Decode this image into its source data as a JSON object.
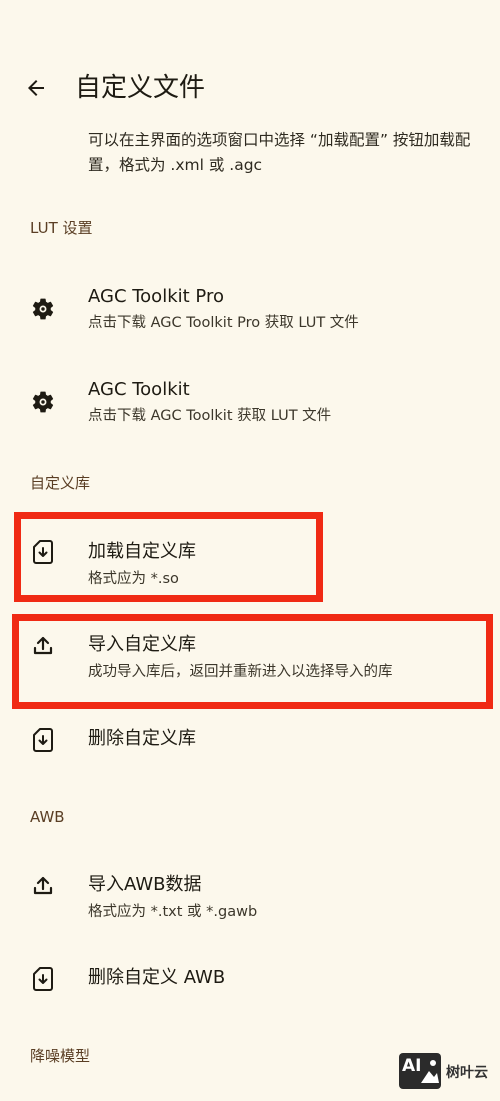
{
  "header": {
    "title": "自定义文件"
  },
  "description": "可以在主界面的选项窗口中选择 “加载配置” 按钮加载配置，格式为 .xml 或 .agc",
  "sections": {
    "lut": {
      "header": "LUT 设置",
      "items": [
        {
          "title": "AGC Toolkit Pro",
          "subtitle": "点击下载 AGC Toolkit Pro 获取 LUT 文件",
          "icon": "gear-icon"
        },
        {
          "title": "AGC Toolkit",
          "subtitle": "点击下载 AGC Toolkit 获取 LUT 文件",
          "icon": "gear-icon"
        }
      ]
    },
    "library": {
      "header": "自定义库",
      "items": [
        {
          "title": "加载自定义库",
          "subtitle": "格式应为 *.so",
          "icon": "file-download-icon"
        },
        {
          "title": "导入自定义库",
          "subtitle": "成功导入库后，返回并重新进入以选择导入的库",
          "icon": "upload-icon"
        },
        {
          "title": "删除自定义库",
          "icon": "file-download-icon"
        }
      ]
    },
    "awb": {
      "header": "AWB",
      "items": [
        {
          "title": "导入AWB数据",
          "subtitle": "格式应为 *.txt 或 *.gawb",
          "icon": "upload-icon"
        },
        {
          "title": "删除自定义 AWB",
          "icon": "file-download-icon"
        }
      ]
    },
    "denoise": {
      "header": "降噪模型"
    }
  },
  "watermark": {
    "badge": "AI",
    "text": "树叶云"
  },
  "colors": {
    "background": "#FCF8EC",
    "highlight": "#F02A14",
    "section_header": "#5A3E24"
  }
}
